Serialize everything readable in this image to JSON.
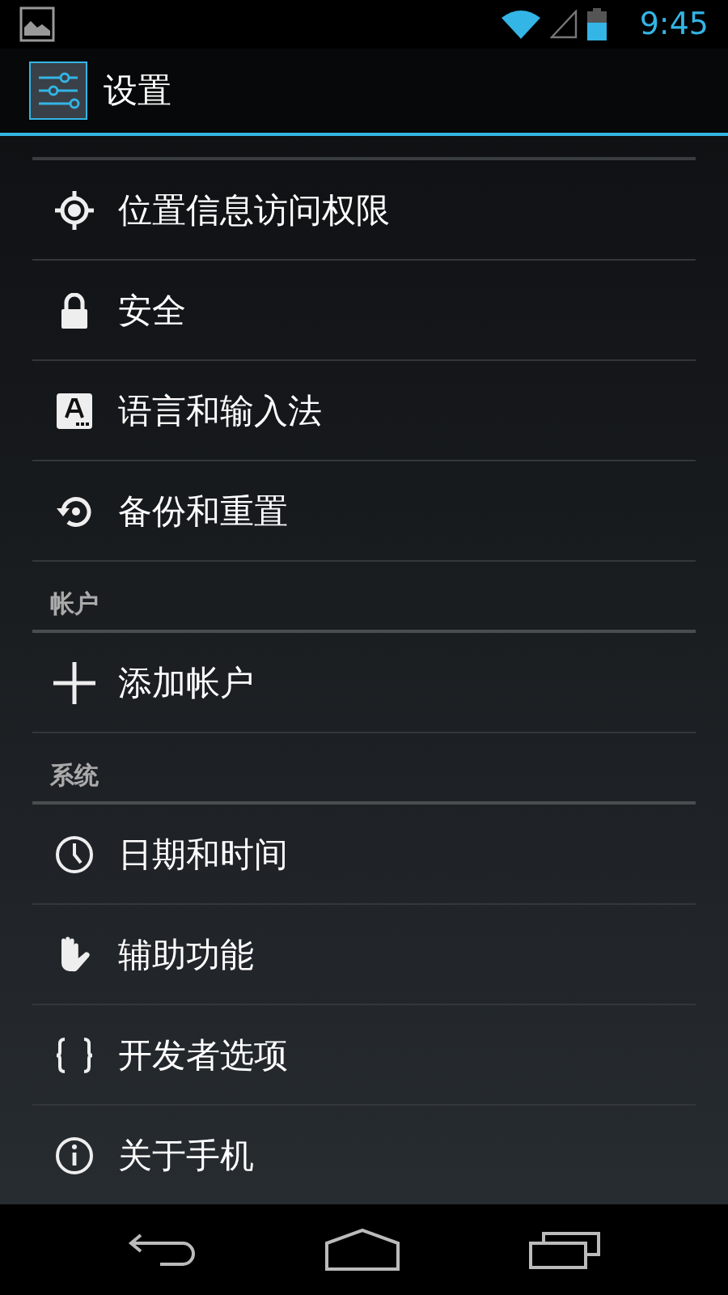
{
  "status_bar": {
    "time": "9:45"
  },
  "action_bar": {
    "title": "设置"
  },
  "sections": [
    {
      "items": [
        {
          "label": "位置信息访问权限"
        },
        {
          "label": "安全"
        },
        {
          "label": "语言和输入法"
        },
        {
          "label": "备份和重置"
        }
      ]
    },
    {
      "title": "帐户",
      "items": [
        {
          "label": "添加帐户"
        }
      ]
    },
    {
      "title": "系统",
      "items": [
        {
          "label": "日期和时间"
        },
        {
          "label": "辅助功能"
        },
        {
          "label": "开发者选项"
        },
        {
          "label": "关于手机"
        }
      ]
    }
  ]
}
